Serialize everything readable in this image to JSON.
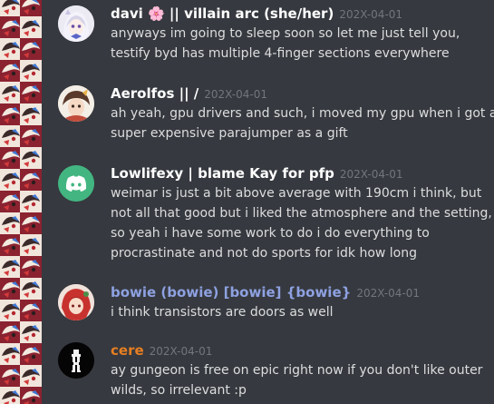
{
  "colors": {
    "background": "#36393f",
    "text": "#dcddde",
    "timestamp": "#72767d",
    "author_default": "#ffffff",
    "author_bowie": "#8ea1e1",
    "author_cere": "#e67e22",
    "discord_blurple": "#43b581"
  },
  "messages": [
    {
      "author": "davi 🌸 || villain arc (she/her)",
      "timestamp": "202X-04-01",
      "lines": [
        "anyways im going to sleep soon so let me just tell you,",
        "testify byd has multiple 4-finger sections everywhere"
      ],
      "avatar_icon": "anime-girl-avatar-icon"
    },
    {
      "author": "Aerolfos || /",
      "timestamp": "202X-04-01",
      "lines": [
        "ah yeah, gpu drivers and such, i moved my gpu when i got a",
        "super expensive parajumper as a gift"
      ],
      "avatar_icon": "character-avatar-icon"
    },
    {
      "author": "Lowlifexy | blame Kay for pfp",
      "timestamp": "202X-04-01",
      "lines": [
        "weimar is just a bit above average with 190cm i think, but",
        "not all that good but i liked the atmosphere and the setting,",
        "so yeah i have some work to do i do everything to",
        "procrastinate and not do sports for idk how long"
      ],
      "avatar_icon": "discord-logo-icon"
    },
    {
      "author": "bowie (bowie) [bowie] {bowie}",
      "timestamp": "202X-04-01",
      "lines": [
        "i think transistors are doors as well"
      ],
      "avatar_icon": "red-hair-avatar-icon"
    },
    {
      "author": "cere",
      "timestamp": "202X-04-01",
      "lines": [
        "ay gungeon is free on epic right now if you don't like outer",
        "wilds, so irrelevant :p"
      ],
      "avatar_icon": "pixel-figure-avatar-icon"
    }
  ]
}
